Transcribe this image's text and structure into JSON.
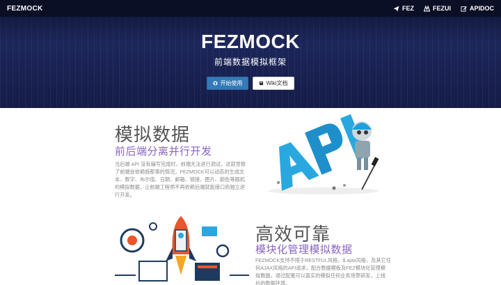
{
  "navbar": {
    "brand": "FEZMOCK",
    "links": [
      {
        "label": "FEZ",
        "icon": "send-icon"
      },
      {
        "label": "FEZUI",
        "icon": "fez-ui-icon"
      },
      {
        "label": "APIDOC",
        "icon": "edit-icon"
      }
    ]
  },
  "hero": {
    "title": "FEZMOCK",
    "subtitle": "前端数据模拟框架",
    "primary_button": "开始使用",
    "secondary_button": "Wiki文档"
  },
  "feature1": {
    "title": "模拟数据",
    "subtitle": "前后端分离并行开发",
    "lines": [
      "当后端 API 没有编写完成时，前端无法进行调试，这就导致",
      "了前端会依赖施那事的情况，FEZMOCK可以动态的生成文",
      "本、数字、布尔值、日期、邮箱、链接、图片、颜色等随机",
      "的模拟数据，让前端工程师不再依赖后端就能接口而独立进",
      "行开发。"
    ]
  },
  "feature2": {
    "title": "高效可靠",
    "subtitle": "模块化管理模拟数据",
    "lines": [
      "FEZMOCK支持不限于RESTFUL风格，$.ajax风格，及其它任",
      "何AJAX风格的API请求，配合数据模板及FEZ模块化管理模",
      "拟数据，通过配置可以真实的模拟任何业务场景研发，上线",
      "后的数据环境。"
    ]
  },
  "colors": {
    "navbar": "#0b0f26",
    "hero": "#1c2450",
    "primary": "#337ab7",
    "accent": "#8a63c2"
  }
}
